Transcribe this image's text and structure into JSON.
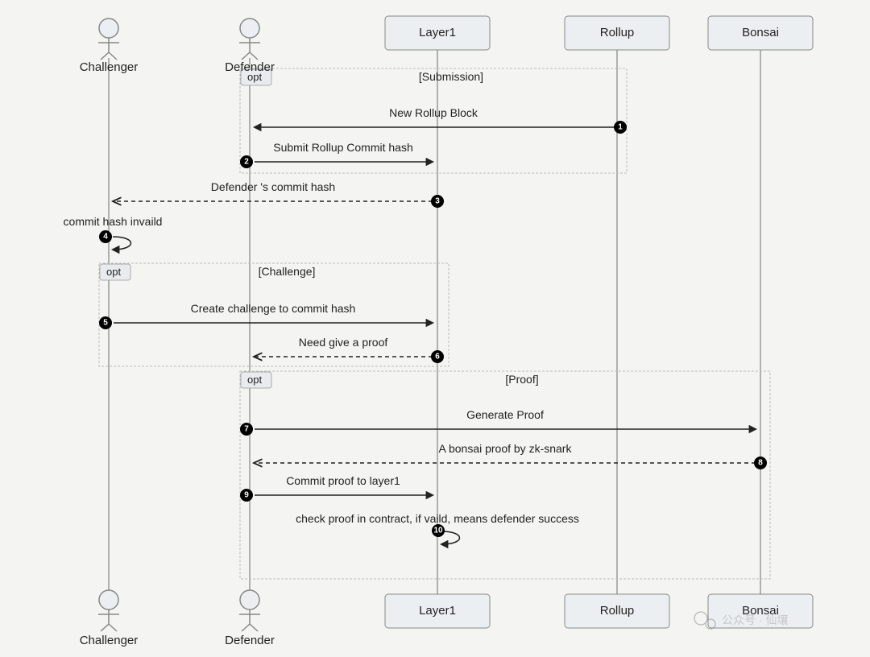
{
  "diagram_type": "sequence",
  "participants": {
    "challenger": {
      "label": "Challenger",
      "kind": "actor"
    },
    "defender": {
      "label": "Defender",
      "kind": "actor"
    },
    "layer1": {
      "label": "Layer1",
      "kind": "box"
    },
    "rollup": {
      "label": "Rollup",
      "kind": "box"
    },
    "bonsai": {
      "label": "Bonsai",
      "kind": "box"
    }
  },
  "fragments": {
    "submission": {
      "tag": "opt",
      "condition": "[Submission]"
    },
    "challenge": {
      "tag": "opt",
      "condition": "[Challenge]"
    },
    "proof": {
      "tag": "opt",
      "condition": "[Proof]"
    }
  },
  "messages": {
    "m1": {
      "seq": "1",
      "text": "New Rollup Block"
    },
    "m2": {
      "seq": "2",
      "text": "Submit Rollup Commit hash"
    },
    "m3": {
      "seq": "3",
      "text": "Defender 's commit hash"
    },
    "m4": {
      "seq": "4",
      "text": "commit hash invaild"
    },
    "m5": {
      "seq": "5",
      "text": "Create challenge to commit hash"
    },
    "m6": {
      "seq": "6",
      "text": "Need give a proof"
    },
    "m7": {
      "seq": "7",
      "text": "Generate Proof"
    },
    "m8": {
      "seq": "8",
      "text": "A bonsai proof by zk-snark"
    },
    "m9": {
      "seq": "9",
      "text": "Commit proof to layer1"
    },
    "m10": {
      "seq": "10",
      "text": "check proof in contract, if vaild, means defender success"
    }
  },
  "watermark": "公众号 · 仙壤"
}
